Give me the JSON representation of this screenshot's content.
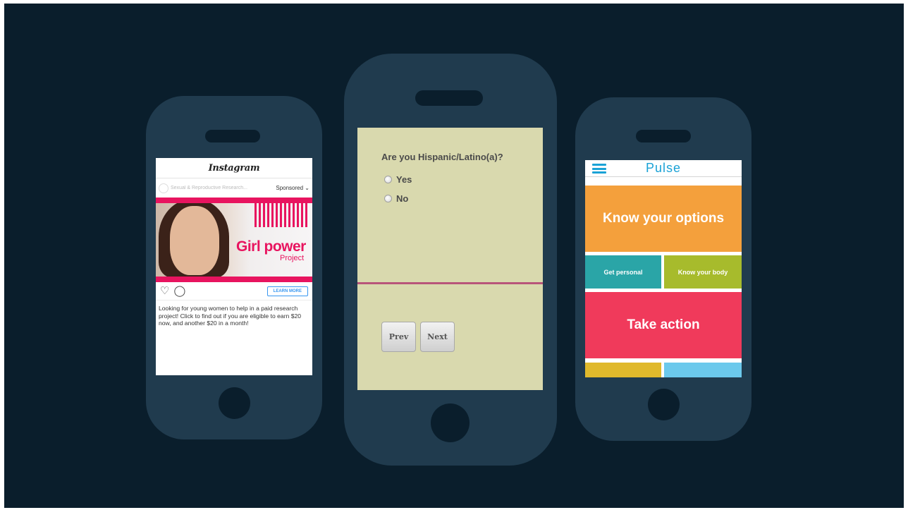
{
  "instagram": {
    "app_name": "Instagram",
    "account_name": "Sexual & Reproductive Research...",
    "sponsored_label": "Sponsored ⌄",
    "banner_logo_girl": "Girl power",
    "banner_logo_project": "Project",
    "learn_more_label": "LEARN MORE",
    "caption": "Looking for young women to help in a paid research project! Click to find out if you are eligible to earn $20 now, and another $20 in a month!",
    "heart_icon": "♡",
    "comment_icon": "◯",
    "accent_color": "#e8145f"
  },
  "survey": {
    "question": "Are you Hispanic/Latino(a)?",
    "options": [
      {
        "label": "Yes"
      },
      {
        "label": "No"
      }
    ],
    "prev_label": "Prev",
    "next_label": "Next",
    "background_color": "#d9d9ae"
  },
  "pulse": {
    "app_name": "Pulse",
    "tiles": {
      "know_your_options": "Know your options",
      "get_personal": "Get personal",
      "know_your_body": "Know your body",
      "take_action": "Take action"
    },
    "brand_color": "#1aa2d6"
  }
}
